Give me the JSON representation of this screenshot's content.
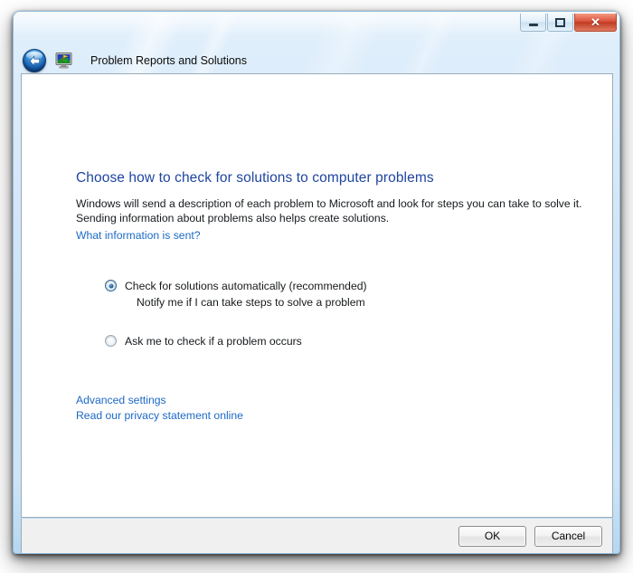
{
  "window": {
    "title": "Problem Reports and Solutions",
    "app_icon_name": "problem-reports-monitor-icon",
    "back_button_label": "Back",
    "caption": {
      "minimize_label": "Minimize",
      "maximize_label": "Maximize",
      "close_label": "Close",
      "close_glyph": "✕"
    },
    "colors": {
      "heading_blue": "#1f45a0",
      "link_blue": "#1d69c5",
      "glass_blue": "#cde3f7",
      "close_red": "#c03b22",
      "command_bar_gray": "#f0f0f0"
    }
  },
  "content": {
    "heading": "Choose how to check for solutions to computer problems",
    "body_line_1": "Windows will send a description of each problem to Microsoft and look for steps you can take to solve it.",
    "body_line_2": "Sending information about problems also helps create solutions.",
    "info_link": "What information is sent?",
    "options": [
      {
        "label": "Check for solutions automatically (recommended)",
        "sublabel": "Notify me if I can take steps to solve a problem",
        "selected": true
      },
      {
        "label": "Ask me to check if a problem occurs",
        "sublabel": "",
        "selected": false
      }
    ],
    "links": [
      {
        "label": "Advanced settings"
      },
      {
        "label": "Read our privacy statement online"
      }
    ]
  },
  "command_bar": {
    "ok_label": "OK",
    "cancel_label": "Cancel"
  }
}
